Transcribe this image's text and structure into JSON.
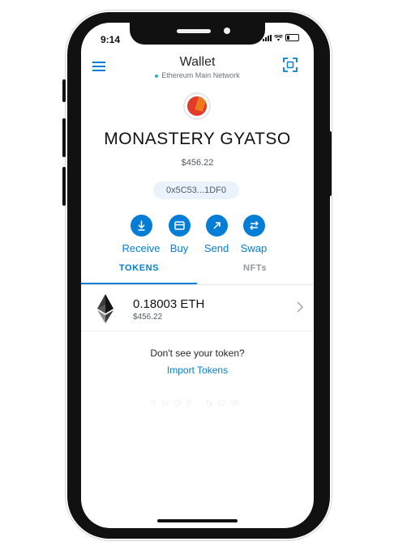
{
  "status_bar": {
    "time": "9:14"
  },
  "header": {
    "title": "Wallet",
    "network": "Ethereum Main Network",
    "menu_icon": "hamburger-menu-icon",
    "scan_icon": "qr-scan-icon"
  },
  "account": {
    "name": "MONASTERY GYATSO",
    "balance": "$456.22",
    "address": "0x5C53...1DF0"
  },
  "actions": [
    {
      "label": "Receive",
      "icon": "download-arrow-icon"
    },
    {
      "label": "Buy",
      "icon": "card-icon"
    },
    {
      "label": "Send",
      "icon": "arrow-up-right-icon"
    },
    {
      "label": "Swap",
      "icon": "swap-arrows-icon"
    }
  ],
  "tabs": [
    {
      "label": "TOKENS",
      "active": true
    },
    {
      "label": "NFTs",
      "active": false
    }
  ],
  "tokens": [
    {
      "amount": "0.18003 ETH",
      "fiat": "$456.22",
      "icon": "ethereum-icon"
    }
  ],
  "import_prompt": {
    "question": "Don't see your token?",
    "link": "Import Tokens"
  },
  "faded_text": "SHOP NOW",
  "colors": {
    "accent": "#037dd6",
    "network_dot": "#29b6af"
  }
}
